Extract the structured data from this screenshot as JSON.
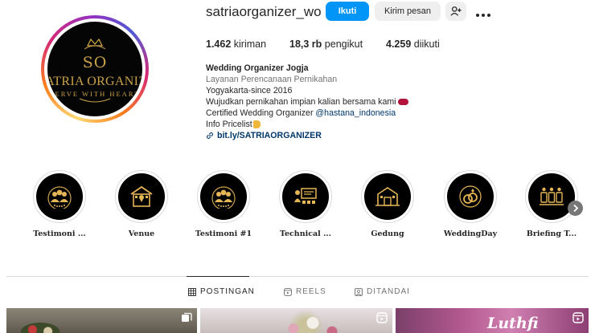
{
  "profile": {
    "username": "satriaorganizer_wo",
    "avatar": {
      "initials": "SO",
      "name": "SATRIA ORGANIZER",
      "tagline": "SERVE WITH HEART"
    },
    "actions": {
      "follow_label": "Ikuti",
      "message_label": "Kirim pesan",
      "suggest_icon": "add-person-icon",
      "more_icon": "more-options-icon"
    },
    "stats": {
      "posts_count": "1.462",
      "posts_label": "kiriman",
      "followers_count": "18,3 rb",
      "followers_label": "pengikut",
      "following_count": "4.259",
      "following_label": "diikuti"
    },
    "bio": {
      "name": "Wedding Organizer Jogja",
      "category": "Layanan Perencanaan Pernikahan",
      "line1": "Yogyakarta-since 2016",
      "line2": "Wujudkan pernikahan impian kalian bersama kami",
      "line3_prefix": "Certified Wedding Organizer ",
      "line3_mention": "@hastana_indonesia",
      "line4": "Info Pricelist",
      "link": "bit.ly/SATRIAORGANIZER"
    }
  },
  "highlights": [
    {
      "label": "Testimoni ...",
      "icon": "group-stars-icon"
    },
    {
      "label": "Venue",
      "icon": "building-location-icon"
    },
    {
      "label": "Testimoni #1",
      "icon": "group-stars-icon"
    },
    {
      "label": "Technical ...",
      "icon": "presentation-icon"
    },
    {
      "label": "Gedung",
      "icon": "building-icon"
    },
    {
      "label": "WeddingDay",
      "icon": "rings-icon"
    },
    {
      "label": "Briefing T...",
      "icon": "team-icon"
    }
  ],
  "tabs": [
    {
      "label": "POSTINGAN",
      "icon": "grid-icon",
      "active": true
    },
    {
      "label": "REELS",
      "icon": "reels-icon",
      "active": false
    },
    {
      "label": "DITANDAI",
      "icon": "tagged-icon",
      "active": false
    }
  ],
  "posts": [
    {
      "type_icon": "carousel-icon"
    },
    {
      "type_icon": "reels-icon"
    },
    {
      "type_icon": "reels-icon",
      "overlay_text": "Luthfi"
    }
  ],
  "colors": {
    "primary_button": "#0095f6",
    "gold": "#caa24a",
    "link": "#00376b"
  }
}
